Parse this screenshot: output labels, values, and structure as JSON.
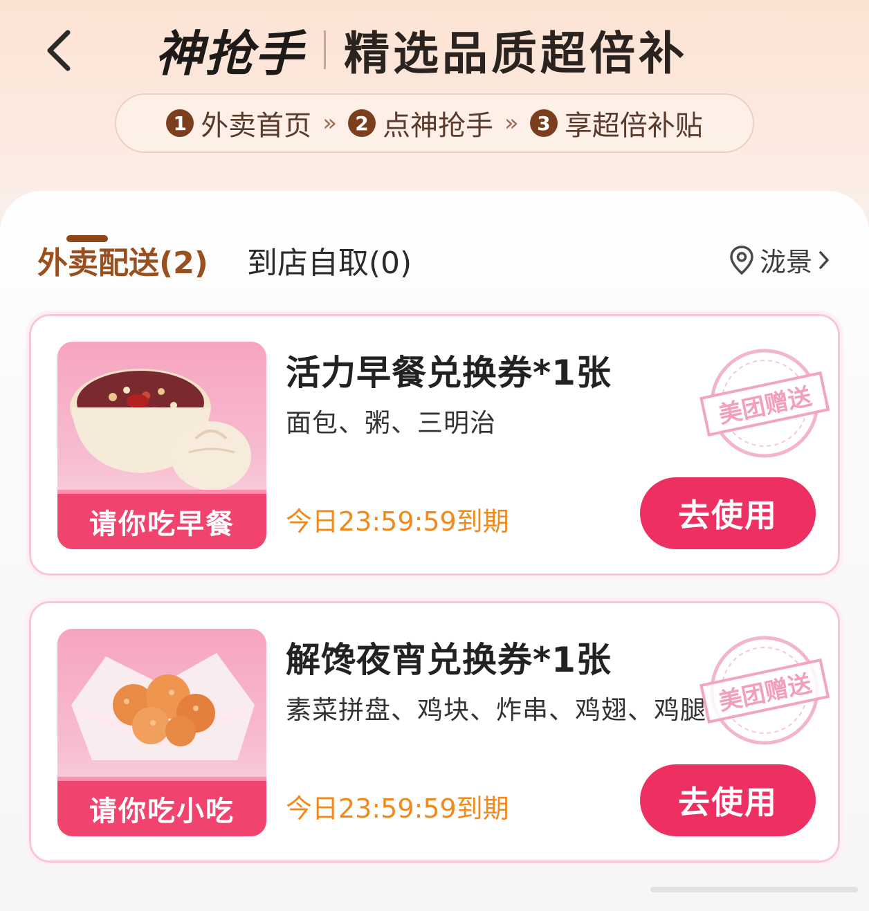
{
  "header": {
    "brand": "神抢手",
    "slogan": "精选品质超倍补",
    "steps": [
      {
        "num": "1",
        "label": "外卖首页"
      },
      {
        "num": "2",
        "label": "点神抢手"
      },
      {
        "num": "3",
        "label": "享超倍补贴"
      }
    ],
    "step_separator": "»"
  },
  "tabs": [
    {
      "label": "外卖配送(2)",
      "active": true
    },
    {
      "label": "到店自取(0)",
      "active": false
    }
  ],
  "location": {
    "label": "泷景",
    "icon": "location-pin-icon"
  },
  "coupons": [
    {
      "image_label": "请你吃早餐",
      "image_icon": "porridge-bun-icon",
      "title": "活力早餐兑换券*1张",
      "items": "面包、粥、三明治",
      "expiry": "今日23:59:59到期",
      "stamp": "美团赠送",
      "button": "去使用"
    },
    {
      "image_label": "请你吃小吃",
      "image_icon": "fried-chicken-icon",
      "title": "解馋夜宵兑换券*1张",
      "items": "素菜拼盘、鸡块、炸串、鸡翅、鸡腿",
      "expiry": "今日23:59:59到期",
      "stamp": "美团赠送",
      "button": "去使用"
    }
  ],
  "colors": {
    "brand_brown": "#9a4f1f",
    "primary_red": "#ee2f62",
    "expiry_orange": "#f08a1d",
    "card_border": "#f7c7d4"
  }
}
